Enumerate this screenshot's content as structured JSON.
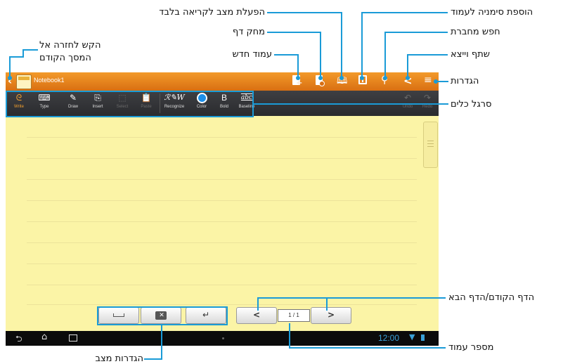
{
  "annotations": {
    "back": [
      "הקש לחזרה אל",
      "המסך הקודם"
    ],
    "read_only": "הפעלת מצב לקריאה בלבד",
    "eraser": "מחק דף",
    "new_page": "עמוד חדש",
    "bookmark": "הוספת סימניה לעמוד",
    "search": "חפש מחברת",
    "share": "שתף וייצא",
    "settings": "הגדרות",
    "toolbar": "סרגל כלים",
    "prev_next": "הדף הקודם/הדף הבא",
    "page_number": "מספר עמוד",
    "mode_settings": "הגדרות מצב"
  },
  "app": {
    "notebook_title": "Notebook1",
    "page_indicator": "1 / 1",
    "clock": "12:00"
  },
  "toolbar": {
    "items": [
      {
        "label": "Write",
        "icon": "write-icon",
        "state": "active"
      },
      {
        "label": "Type",
        "icon": "keyboard-icon",
        "state": "normal"
      },
      {
        "label": "Draw",
        "icon": "draw-icon",
        "state": "normal"
      },
      {
        "label": "Insert",
        "icon": "insert-icon",
        "state": "normal"
      },
      {
        "label": "Select",
        "icon": "select-icon",
        "state": "disabled"
      },
      {
        "label": "Paste",
        "icon": "paste-icon",
        "state": "disabled"
      },
      {
        "label": "Recognize",
        "icon": "recognize-icon",
        "state": "normal"
      },
      {
        "label": "Color",
        "icon": "color-icon",
        "state": "normal"
      },
      {
        "label": "Bold",
        "icon": "bold-icon",
        "state": "normal"
      },
      {
        "label": "Baseline",
        "icon": "baseline-icon",
        "state": "normal"
      },
      {
        "label": "Undo",
        "icon": "undo-icon",
        "state": "disabled"
      },
      {
        "label": "Redo",
        "icon": "redo-icon",
        "state": "disabled"
      }
    ],
    "recognize_glyph": "ℛ✎W",
    "bold_glyph": "B",
    "baseline_glyph": "abc"
  },
  "colors": {
    "accent": "#1a9bd7",
    "titlebar": "#e8841c",
    "paper": "#fbf4a6",
    "active_tool": "#f3a02e",
    "color_swatch": "#1e8fe8",
    "clock": "#3aa0d8"
  }
}
